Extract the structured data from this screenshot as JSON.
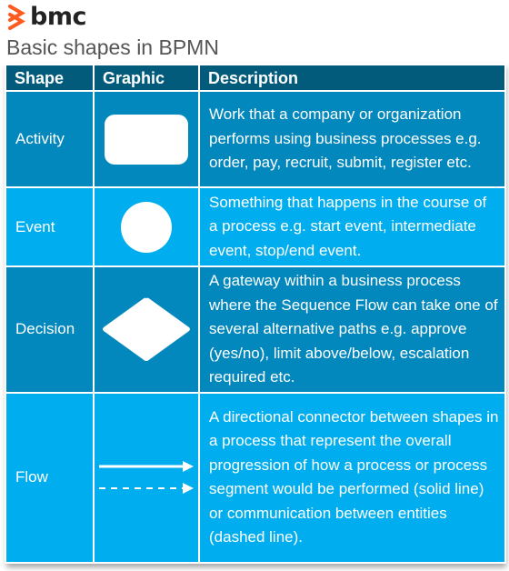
{
  "brand": {
    "name": "bmc",
    "logo_icon": "bmc-logo-icon",
    "logo_color": "#ff5a1f"
  },
  "title": "Basic shapes in BPMN",
  "colors": {
    "header": "#035b7c",
    "row_dark": "#0288bd",
    "row_light": "#00aeef"
  },
  "table": {
    "headers": [
      "Shape",
      "Graphic",
      "Description"
    ],
    "rows": [
      {
        "shape": "Activity",
        "graphic": "rounded-rectangle",
        "description": "Work that a company or organization performs using business processes e.g. order, pay, recruit, submit, register etc."
      },
      {
        "shape": "Event",
        "graphic": "circle",
        "description": "Something that happens in the course of a process e.g. start event, intermediate event, stop/end event."
      },
      {
        "shape": "Decision",
        "graphic": "diamond",
        "description": "A gateway within a business process where the Sequence Flow can take one of several alternative paths e.g. approve (yes/no), limit above/below, escalation required etc."
      },
      {
        "shape": "Flow",
        "graphic": "arrows-solid-and-dashed",
        "description": "A directional connector between shapes in a process that represent the overall progression of how a process or process segment would be performed (solid line) or communication between entities (dashed line)."
      }
    ]
  }
}
